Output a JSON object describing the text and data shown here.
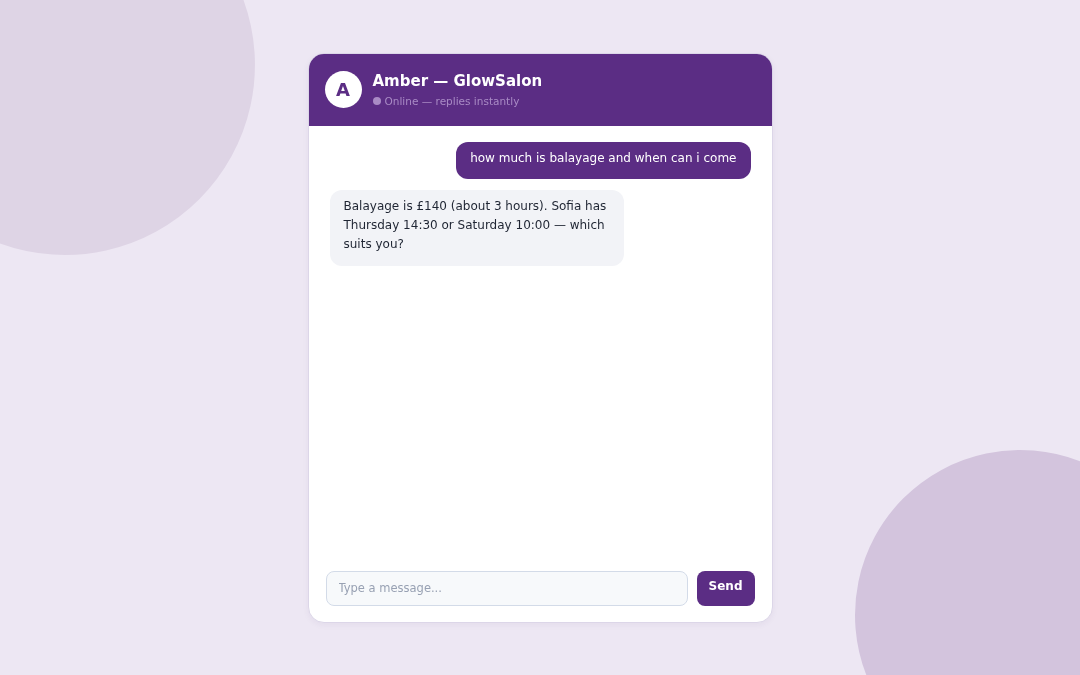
{
  "chat": {
    "header": {
      "avatar": "A",
      "title": "Amber — GlowSalon",
      "online": true,
      "status": "Online — replies instantly"
    },
    "messages": [
      {
        "kind": "user",
        "text": "how much is balayage and when can i come"
      },
      {
        "kind": "agent",
        "text": "Balayage is £140 (about 3 hours). Sofia has Thursday 14:30 or Saturday 10:00 — which suits you?"
      }
    ],
    "composer": {
      "placeholder": "Type a message...",
      "button": "Send"
    }
  }
}
